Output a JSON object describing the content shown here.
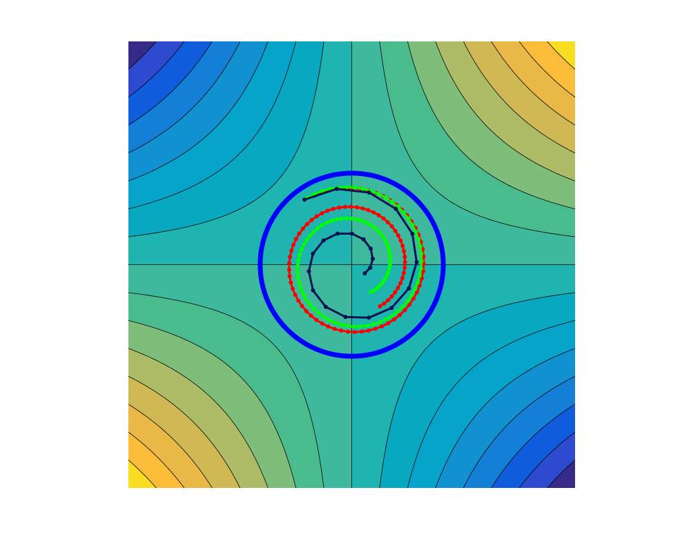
{
  "chart_data": {
    "type": "contour",
    "title": "",
    "xlabel": "",
    "ylabel": "",
    "xlim": [
      -2,
      2
    ],
    "ylim": [
      -2,
      2
    ],
    "axis_visible": false,
    "grid": false,
    "legend": "none",
    "surface": {
      "expression": "x*y",
      "levels": [
        -4,
        -3.5,
        -3,
        -2.5,
        -2,
        -1.5,
        -1,
        -0.5,
        0,
        0.5,
        1,
        1.5,
        2,
        2.5,
        3,
        3.5,
        4
      ],
      "colormap": [
        "#352a87",
        "#2e4bd0",
        "#0f5cdd",
        "#137fd6",
        "#1191cf",
        "#06a4ca",
        "#08a8c0",
        "#1fb4b0",
        "#3eb99d",
        "#4abb8c",
        "#7fbd7a",
        "#aebc68",
        "#d0b855",
        "#e9b846",
        "#fbbc3a",
        "#f8dd22",
        "#f9fb0e"
      ],
      "contour_line_color": "#000000"
    },
    "series": [
      {
        "color": "#0000ff",
        "style": "circle",
        "marker": true,
        "radius": 0.82,
        "center": [
          0,
          0
        ]
      },
      {
        "color": "#ff0000",
        "style": "spiral",
        "marker": true,
        "start_angle_deg": 118,
        "end_angle_deg": -416,
        "start_radius": 0.7,
        "end_radius": 0.45,
        "points": 92
      },
      {
        "color": "#00ff00",
        "style": "spiral",
        "marker": true,
        "start_angle_deg": 124,
        "end_angle_deg": -415,
        "start_radius": 0.72,
        "end_radius": 0.3,
        "points": 90
      },
      {
        "color": "#0a1450",
        "style": "spiral",
        "marker": true,
        "start_angle_deg": 126,
        "end_angle_deg": -394,
        "start_radius": 0.72,
        "end_radius": 0.14,
        "points": 22
      }
    ]
  }
}
